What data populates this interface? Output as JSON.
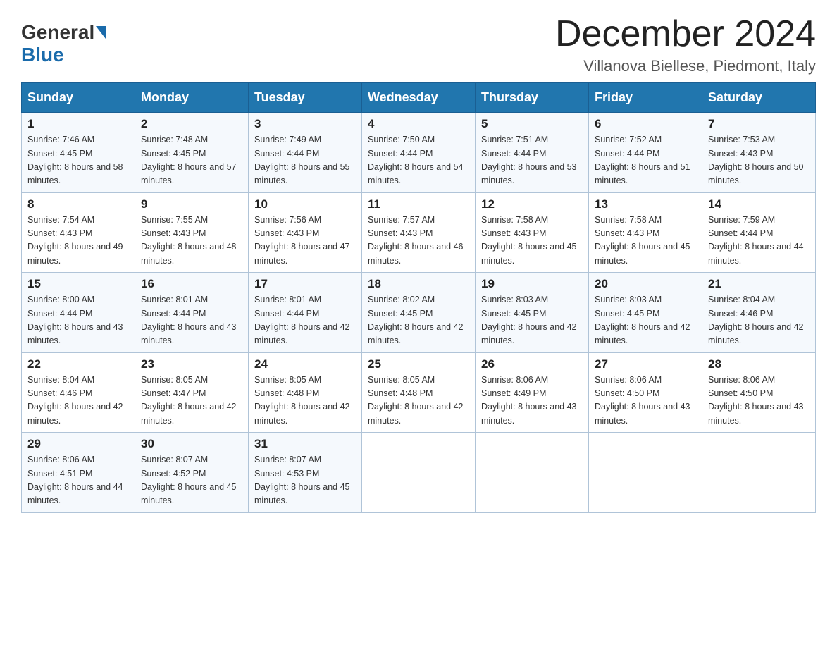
{
  "logo": {
    "general": "General",
    "blue": "Blue"
  },
  "title": "December 2024",
  "subtitle": "Villanova Biellese, Piedmont, Italy",
  "days_of_week": [
    "Sunday",
    "Monday",
    "Tuesday",
    "Wednesday",
    "Thursday",
    "Friday",
    "Saturday"
  ],
  "weeks": [
    [
      {
        "day": "1",
        "sunrise": "7:46 AM",
        "sunset": "4:45 PM",
        "daylight": "8 hours and 58 minutes."
      },
      {
        "day": "2",
        "sunrise": "7:48 AM",
        "sunset": "4:45 PM",
        "daylight": "8 hours and 57 minutes."
      },
      {
        "day": "3",
        "sunrise": "7:49 AM",
        "sunset": "4:44 PM",
        "daylight": "8 hours and 55 minutes."
      },
      {
        "day": "4",
        "sunrise": "7:50 AM",
        "sunset": "4:44 PM",
        "daylight": "8 hours and 54 minutes."
      },
      {
        "day": "5",
        "sunrise": "7:51 AM",
        "sunset": "4:44 PM",
        "daylight": "8 hours and 53 minutes."
      },
      {
        "day": "6",
        "sunrise": "7:52 AM",
        "sunset": "4:44 PM",
        "daylight": "8 hours and 51 minutes."
      },
      {
        "day": "7",
        "sunrise": "7:53 AM",
        "sunset": "4:43 PM",
        "daylight": "8 hours and 50 minutes."
      }
    ],
    [
      {
        "day": "8",
        "sunrise": "7:54 AM",
        "sunset": "4:43 PM",
        "daylight": "8 hours and 49 minutes."
      },
      {
        "day": "9",
        "sunrise": "7:55 AM",
        "sunset": "4:43 PM",
        "daylight": "8 hours and 48 minutes."
      },
      {
        "day": "10",
        "sunrise": "7:56 AM",
        "sunset": "4:43 PM",
        "daylight": "8 hours and 47 minutes."
      },
      {
        "day": "11",
        "sunrise": "7:57 AM",
        "sunset": "4:43 PM",
        "daylight": "8 hours and 46 minutes."
      },
      {
        "day": "12",
        "sunrise": "7:58 AM",
        "sunset": "4:43 PM",
        "daylight": "8 hours and 45 minutes."
      },
      {
        "day": "13",
        "sunrise": "7:58 AM",
        "sunset": "4:43 PM",
        "daylight": "8 hours and 45 minutes."
      },
      {
        "day": "14",
        "sunrise": "7:59 AM",
        "sunset": "4:44 PM",
        "daylight": "8 hours and 44 minutes."
      }
    ],
    [
      {
        "day": "15",
        "sunrise": "8:00 AM",
        "sunset": "4:44 PM",
        "daylight": "8 hours and 43 minutes."
      },
      {
        "day": "16",
        "sunrise": "8:01 AM",
        "sunset": "4:44 PM",
        "daylight": "8 hours and 43 minutes."
      },
      {
        "day": "17",
        "sunrise": "8:01 AM",
        "sunset": "4:44 PM",
        "daylight": "8 hours and 42 minutes."
      },
      {
        "day": "18",
        "sunrise": "8:02 AM",
        "sunset": "4:45 PM",
        "daylight": "8 hours and 42 minutes."
      },
      {
        "day": "19",
        "sunrise": "8:03 AM",
        "sunset": "4:45 PM",
        "daylight": "8 hours and 42 minutes."
      },
      {
        "day": "20",
        "sunrise": "8:03 AM",
        "sunset": "4:45 PM",
        "daylight": "8 hours and 42 minutes."
      },
      {
        "day": "21",
        "sunrise": "8:04 AM",
        "sunset": "4:46 PM",
        "daylight": "8 hours and 42 minutes."
      }
    ],
    [
      {
        "day": "22",
        "sunrise": "8:04 AM",
        "sunset": "4:46 PM",
        "daylight": "8 hours and 42 minutes."
      },
      {
        "day": "23",
        "sunrise": "8:05 AM",
        "sunset": "4:47 PM",
        "daylight": "8 hours and 42 minutes."
      },
      {
        "day": "24",
        "sunrise": "8:05 AM",
        "sunset": "4:48 PM",
        "daylight": "8 hours and 42 minutes."
      },
      {
        "day": "25",
        "sunrise": "8:05 AM",
        "sunset": "4:48 PM",
        "daylight": "8 hours and 42 minutes."
      },
      {
        "day": "26",
        "sunrise": "8:06 AM",
        "sunset": "4:49 PM",
        "daylight": "8 hours and 43 minutes."
      },
      {
        "day": "27",
        "sunrise": "8:06 AM",
        "sunset": "4:50 PM",
        "daylight": "8 hours and 43 minutes."
      },
      {
        "day": "28",
        "sunrise": "8:06 AM",
        "sunset": "4:50 PM",
        "daylight": "8 hours and 43 minutes."
      }
    ],
    [
      {
        "day": "29",
        "sunrise": "8:06 AM",
        "sunset": "4:51 PM",
        "daylight": "8 hours and 44 minutes."
      },
      {
        "day": "30",
        "sunrise": "8:07 AM",
        "sunset": "4:52 PM",
        "daylight": "8 hours and 45 minutes."
      },
      {
        "day": "31",
        "sunrise": "8:07 AM",
        "sunset": "4:53 PM",
        "daylight": "8 hours and 45 minutes."
      },
      null,
      null,
      null,
      null
    ]
  ]
}
